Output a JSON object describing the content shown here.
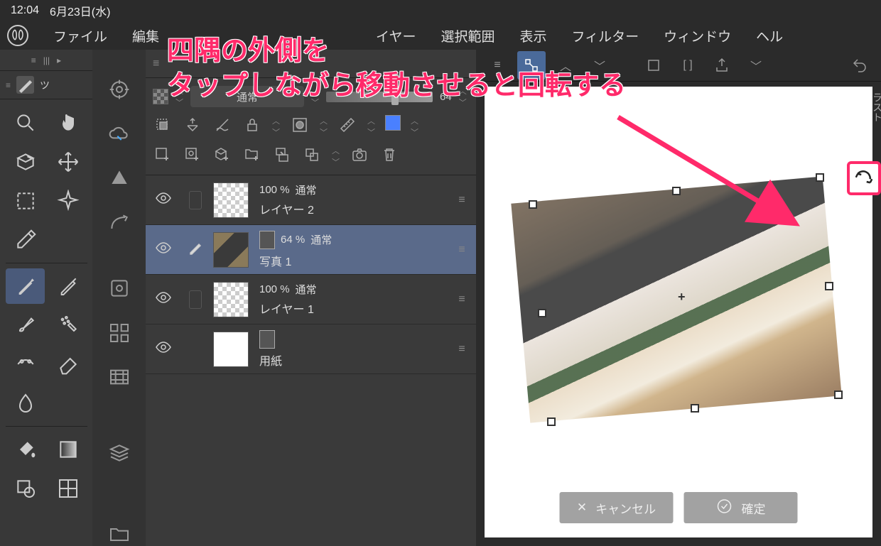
{
  "status_bar": {
    "time": "12:04",
    "date": "6月23日(水)"
  },
  "menu": {
    "file": "ファイル",
    "edit": "編集",
    "layer": "イヤー",
    "select": "選択範囲",
    "view": "表示",
    "filter": "フィルター",
    "window": "ウィンドウ",
    "help": "ヘル"
  },
  "subtool": {
    "label": "ツ"
  },
  "layer_panel": {
    "blend_mode": "通常",
    "opacity_value": "64",
    "layers": [
      {
        "opacity": "100 %",
        "blend": "通常",
        "name": "レイヤー 2"
      },
      {
        "opacity": "64 %",
        "blend": "通常",
        "name": "写真 1"
      },
      {
        "opacity": "100 %",
        "blend": "通常",
        "name": "レイヤー 1"
      },
      {
        "name": "用紙"
      }
    ]
  },
  "right_tab": "ラスト",
  "confirm_bar": {
    "cancel": "キャンセル",
    "ok": "確定"
  },
  "annotation": {
    "line1": "四隅の外側を",
    "line2": "タップしながら移動させると回転する"
  }
}
